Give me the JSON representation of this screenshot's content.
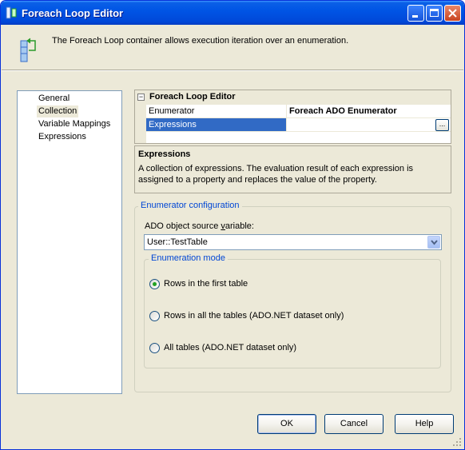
{
  "window": {
    "title": "Foreach Loop Editor",
    "header_text": "The Foreach Loop container allows execution iteration over an enumeration."
  },
  "nav": {
    "items": [
      "General",
      "Collection",
      "Variable Mappings",
      "Expressions"
    ],
    "selected": "Collection"
  },
  "property_grid": {
    "category": "Foreach Loop Editor",
    "rows": [
      {
        "name": "Enumerator",
        "value": "Foreach ADO Enumerator"
      },
      {
        "name": "Expressions",
        "value": ""
      }
    ],
    "ellipsis": "..."
  },
  "description": {
    "title": "Expressions",
    "text": "A collection of expressions. The evaluation result of each expression is assigned to a property and replaces the value of the property."
  },
  "enumerator_config": {
    "group_label": "Enumerator configuration",
    "ado_label": "ADO object source variable:",
    "ado_value": "User::TestTable",
    "mode_label": "Enumeration mode",
    "options": [
      {
        "label": "Rows in the first table",
        "checked": true
      },
      {
        "label": "Rows in all the tables (ADO.NET dataset only)",
        "checked": false
      },
      {
        "label": "All tables (ADO.NET dataset only)",
        "checked": false
      }
    ]
  },
  "buttons": {
    "ok": "OK",
    "cancel": "Cancel",
    "help": "Help"
  },
  "colors": {
    "titlebar": "#0055e5",
    "selection": "#316ac5",
    "group_label": "#0046d5",
    "radio_dot": "#21a121"
  }
}
